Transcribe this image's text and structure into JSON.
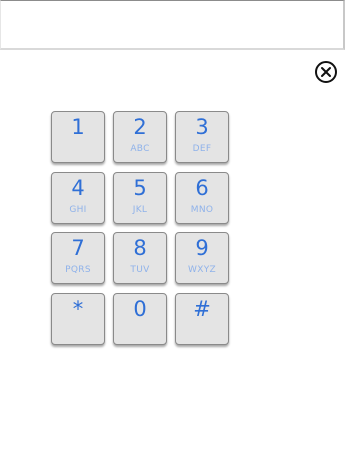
{
  "input": {
    "value": ""
  },
  "close_icon": "close-circle-icon",
  "colors": {
    "digit": "#2f6fd6",
    "letters": "#8fb2ea",
    "key_background": "#e4e4e4"
  },
  "keypad": {
    "keys": [
      {
        "digit": "1",
        "letters": ""
      },
      {
        "digit": "2",
        "letters": "ABC"
      },
      {
        "digit": "3",
        "letters": "DEF"
      },
      {
        "digit": "4",
        "letters": "GHI"
      },
      {
        "digit": "5",
        "letters": "JKL"
      },
      {
        "digit": "6",
        "letters": "MNO"
      },
      {
        "digit": "7",
        "letters": "PQRS"
      },
      {
        "digit": "8",
        "letters": "TUV"
      },
      {
        "digit": "9",
        "letters": "WXYZ"
      },
      {
        "digit": "*",
        "letters": ""
      },
      {
        "digit": "0",
        "letters": ""
      },
      {
        "digit": "#",
        "letters": ""
      }
    ]
  }
}
